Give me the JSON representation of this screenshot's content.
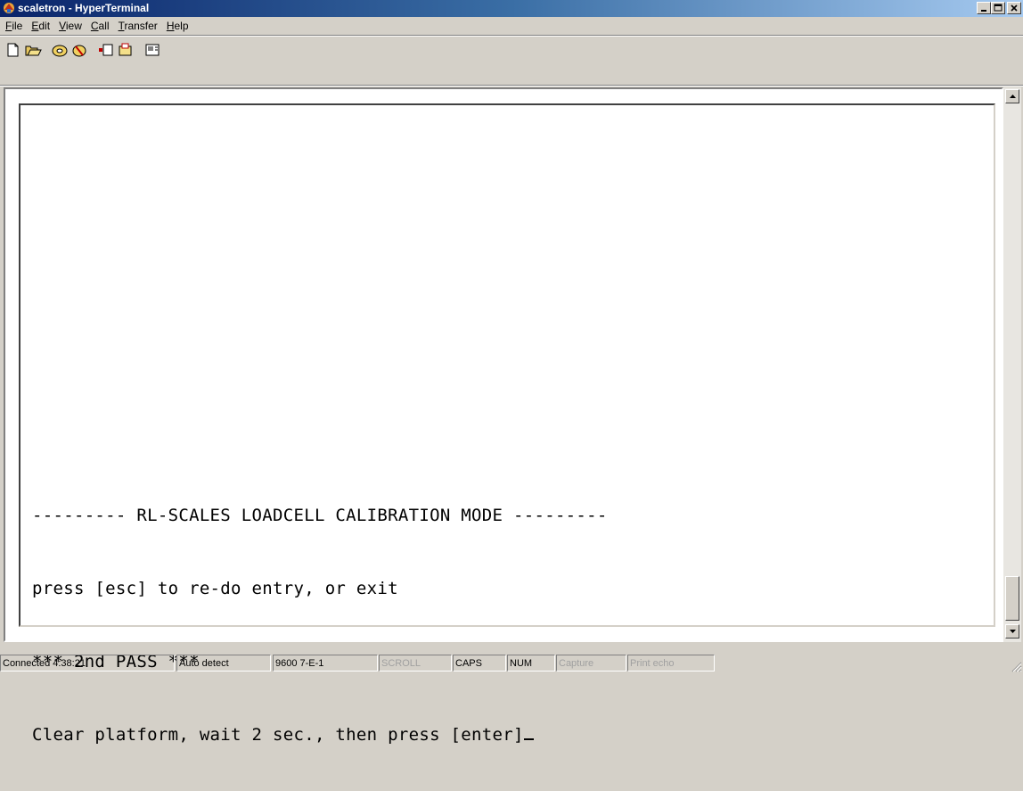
{
  "window": {
    "title": "scaletron - HyperTerminal",
    "controls": [
      "minimize",
      "maximize",
      "close"
    ]
  },
  "menu": {
    "items": [
      {
        "label": "File",
        "mnemonic": "F"
      },
      {
        "label": "Edit",
        "mnemonic": "E"
      },
      {
        "label": "View",
        "mnemonic": "V"
      },
      {
        "label": "Call",
        "mnemonic": "C"
      },
      {
        "label": "Transfer",
        "mnemonic": "T"
      },
      {
        "label": "Help",
        "mnemonic": "H"
      }
    ]
  },
  "toolbar": {
    "buttons": [
      "new-icon",
      "open-icon",
      "call-icon",
      "disconnect-icon",
      "send-icon",
      "receive-icon",
      "properties-icon"
    ]
  },
  "terminal": {
    "lines": [
      "--------- RL-SCALES LOADCELL CALIBRATION MODE ---------",
      "press [esc] to re-do entry, or exit",
      "*** 2nd PASS ***",
      "Clear platform, wait 2 sec., then press [enter]"
    ]
  },
  "status": {
    "connection": "Connected 4:38:21",
    "detect": "Auto detect",
    "settings": "9600 7-E-1",
    "scroll": "SCROLL",
    "caps": "CAPS",
    "num": "NUM",
    "capture": "Capture",
    "print_echo": "Print echo"
  },
  "colors": {
    "titlebar_start": "#0a246a",
    "titlebar_end": "#a6caf0",
    "chrome": "#d4d0c8",
    "terminal_bg": "#ffffff"
  }
}
